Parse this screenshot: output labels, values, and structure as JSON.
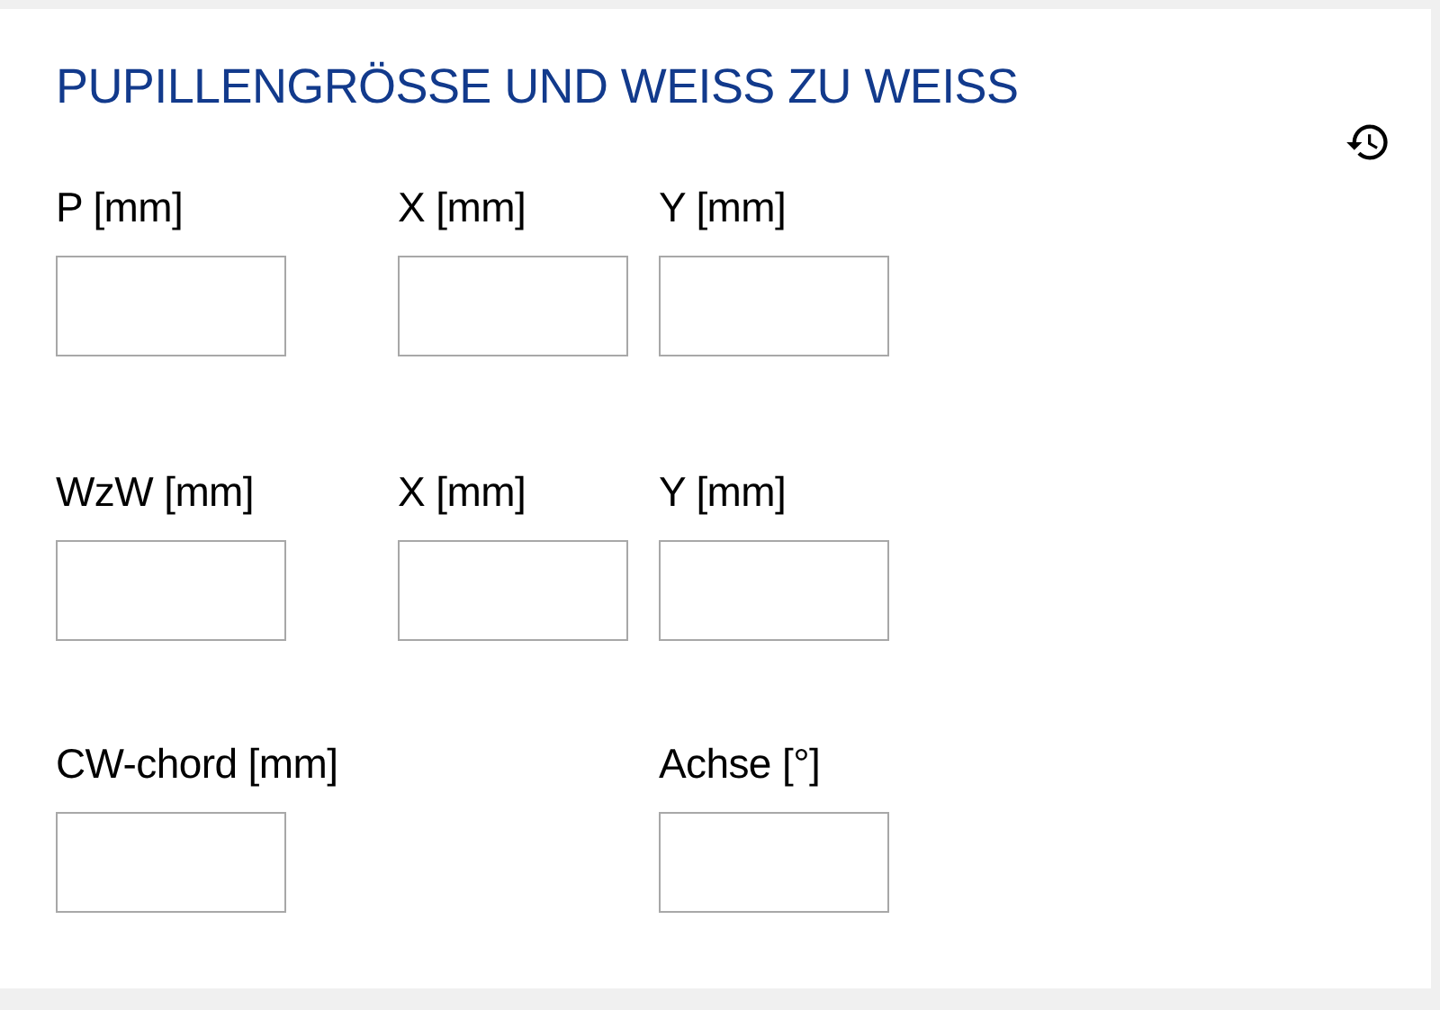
{
  "title": "PUPILLENGRÖSSE UND WEISS ZU WEISS",
  "rows": [
    {
      "fields": [
        {
          "label": "P [mm]"
        },
        {
          "label": "X [mm]"
        },
        {
          "label": "Y [mm]"
        }
      ]
    },
    {
      "fields": [
        {
          "label": "WzW [mm]"
        },
        {
          "label": "X [mm]"
        },
        {
          "label": "Y [mm]"
        }
      ]
    },
    {
      "fields": [
        {
          "label": "CW-chord [mm]",
          "kind": "wide"
        },
        {
          "label": "Achse [°]"
        }
      ]
    }
  ]
}
